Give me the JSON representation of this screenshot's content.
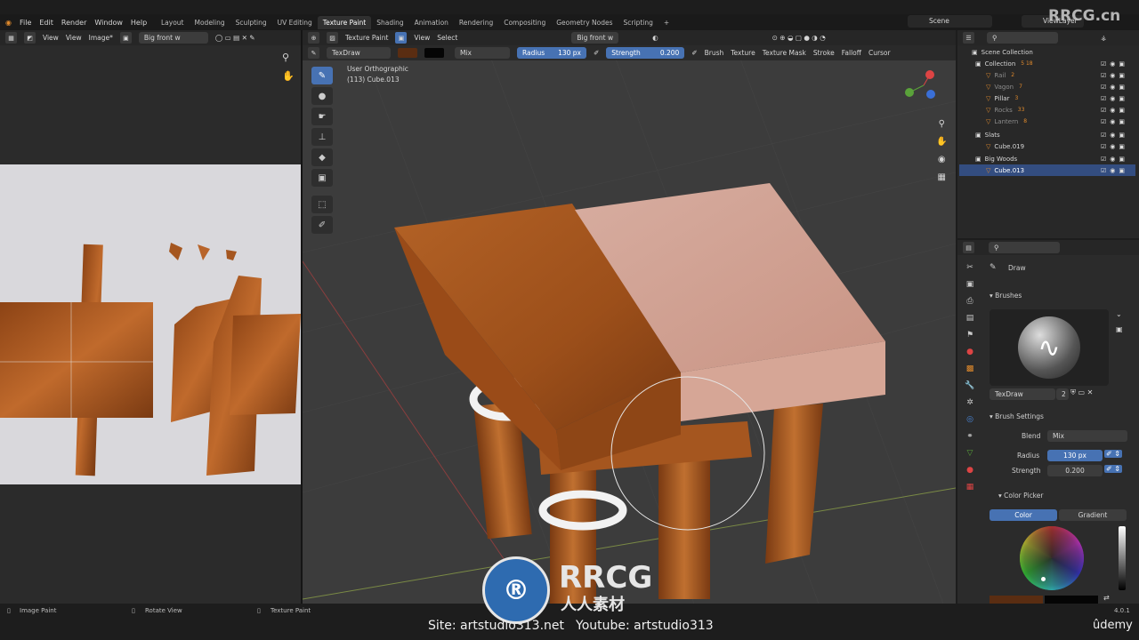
{
  "brand": {
    "top_right": "RRCG.cn",
    "big": "RRCG",
    "sub": "人人素材",
    "udemy": "ûdemy",
    "version": "4.0.1"
  },
  "menu": [
    "File",
    "Edit",
    "Render",
    "Window",
    "Help"
  ],
  "workspace_tabs": [
    "Layout",
    "Modeling",
    "Sculpting",
    "UV Editing",
    "Texture Paint",
    "Shading",
    "Animation",
    "Rendering",
    "Compositing",
    "Geometry Nodes",
    "Scripting"
  ],
  "active_tab": "Texture Paint",
  "scene_name": "Scene",
  "view_layer": "ViewLayer",
  "image_editor": {
    "view": "View",
    "view2": "View",
    "image": "Image*",
    "image_name": "Big front w"
  },
  "viewport_header": {
    "mode": "Texture Paint",
    "view": "View",
    "select": "Select",
    "image_name": "Big front w"
  },
  "tool_header": {
    "brush": "TexDraw",
    "blend": "Mix",
    "radius_label": "Radius",
    "radius_value": "130 px",
    "strength_label": "Strength",
    "strength_value": "0.200",
    "menus": [
      "Brush",
      "Texture",
      "Texture Mask",
      "Stroke",
      "Falloff",
      "Cursor"
    ]
  },
  "viewport_overlay": {
    "view_name": "User Orthographic",
    "object": "(113) Cube.013"
  },
  "outliner": {
    "root": "Scene Collection",
    "rows": [
      {
        "name": "Collection",
        "count": "5 18",
        "dim": false,
        "indent": 1
      },
      {
        "name": "Rail",
        "count": "2",
        "dim": true,
        "indent": 2
      },
      {
        "name": "Vagon",
        "count": "7",
        "dim": true,
        "indent": 2
      },
      {
        "name": "Pillar",
        "count": "3",
        "dim": false,
        "indent": 2
      },
      {
        "name": "Rocks",
        "count": "33",
        "dim": true,
        "indent": 2
      },
      {
        "name": "Lantern",
        "count": "8",
        "dim": true,
        "indent": 2
      },
      {
        "name": "Slats",
        "count": "",
        "dim": false,
        "indent": 1
      },
      {
        "name": "Cube.019",
        "count": "",
        "dim": false,
        "indent": 2
      },
      {
        "name": "Big Woods",
        "count": "",
        "dim": false,
        "indent": 1
      },
      {
        "name": "Cube.013",
        "count": "",
        "dim": false,
        "indent": 2
      }
    ]
  },
  "properties": {
    "tool_name": "Draw",
    "brushes_title": "Brushes",
    "brush_name": "TexDraw",
    "brush_users": "2",
    "brush_settings_title": "Brush Settings",
    "blend_label": "Blend",
    "blend_value": "Mix",
    "radius_label": "Radius",
    "radius_value": "130 px",
    "strength_label": "Strength",
    "strength_value": "0.200",
    "color_picker_title": "Color Picker",
    "color_tab": "Color",
    "gradient_tab": "Gradient"
  },
  "status_bar": [
    "Image Paint",
    "Rotate View",
    "Texture Paint"
  ],
  "footer_text": {
    "site": "Site: artstudio313.net",
    "youtube": "Youtube: artstudio313"
  },
  "colors": {
    "accent": "#4772b3",
    "wood": "#a5561f",
    "highlight": "#334d80",
    "paint_color": "#5a2d12"
  }
}
